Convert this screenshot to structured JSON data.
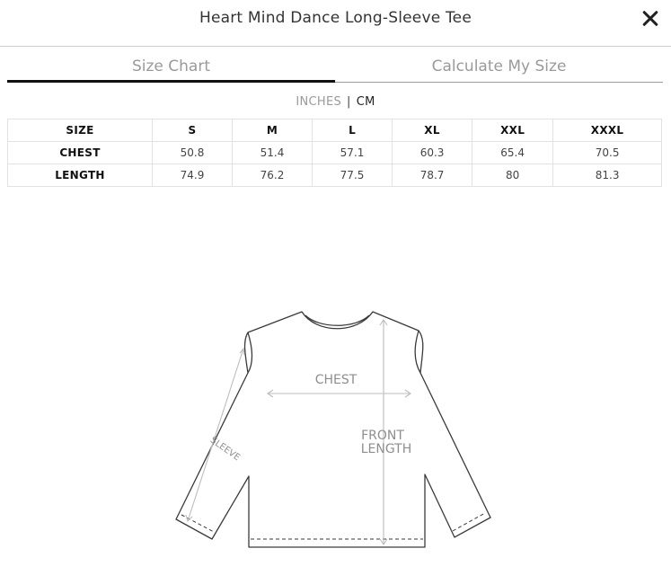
{
  "header": {
    "title": "Heart Mind Dance Long-Sleeve Tee",
    "close_icon": "close-icon"
  },
  "tabs": [
    {
      "label": "Size Chart",
      "active": true
    },
    {
      "label": "Calculate My Size",
      "active": false
    }
  ],
  "units": {
    "inches": "INCHES",
    "separator": "|",
    "cm": "CM",
    "selected": "CM"
  },
  "size_table": {
    "headers": [
      "SIZE",
      "S",
      "M",
      "L",
      "XL",
      "XXL",
      "XXXL"
    ],
    "rows": [
      {
        "label": "CHEST",
        "values": [
          "50.8",
          "51.4",
          "57.1",
          "60.3",
          "65.4",
          "70.5"
        ]
      },
      {
        "label": "LENGTH",
        "values": [
          "74.9",
          "76.2",
          "77.5",
          "78.7",
          "80",
          "81.3"
        ]
      }
    ]
  },
  "diagram": {
    "chest_label": "CHEST",
    "front_length_line1": "FRONT",
    "front_length_line2": "LENGTH",
    "sleeve_label": "SLEEVE"
  }
}
